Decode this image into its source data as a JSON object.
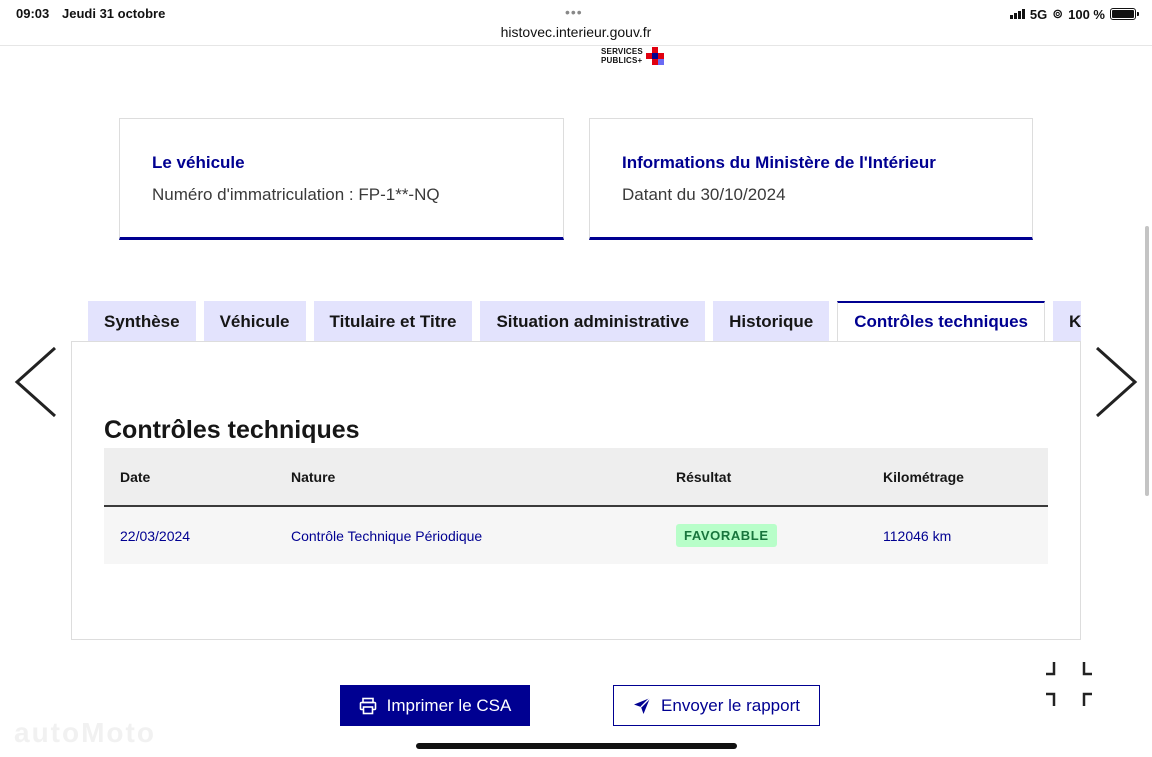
{
  "status_bar": {
    "time": "09:03",
    "date": "Jeudi 31 octobre",
    "url": "histovec.interieur.gouv.fr",
    "network": "5G",
    "battery": "100 %"
  },
  "logo": {
    "line1": "SERVICES",
    "line2": "PUBLICS+"
  },
  "cards": {
    "vehicle": {
      "title": "Le véhicule",
      "text": "Numéro d'immatriculation : FP-1**-NQ"
    },
    "ministry": {
      "title": "Informations du Ministère de l'Intérieur",
      "text": "Datant du 30/10/2024"
    }
  },
  "tabs": [
    {
      "label": "Synthèse"
    },
    {
      "label": "Véhicule"
    },
    {
      "label": "Titulaire et Titre"
    },
    {
      "label": "Situation administrative"
    },
    {
      "label": "Historique"
    },
    {
      "label": "Contrôles techniques"
    },
    {
      "label": "Kilométrage"
    }
  ],
  "section": {
    "title": "Contrôles techniques"
  },
  "table": {
    "headers": {
      "date": "Date",
      "nature": "Nature",
      "result": "Résultat",
      "mileage": "Kilométrage"
    },
    "rows": [
      {
        "date": "22/03/2024",
        "nature": "Contrôle Technique Périodique",
        "result": "FAVORABLE",
        "mileage": "112046 km"
      }
    ]
  },
  "buttons": {
    "print": "Imprimer le CSA",
    "send": "Envoyer le rapport"
  },
  "watermark": "autoMoto",
  "colors": {
    "primary": "#000091",
    "tab_bg": "#e3e3fd",
    "success_bg": "#b8fec9",
    "success_text": "#18753c"
  }
}
